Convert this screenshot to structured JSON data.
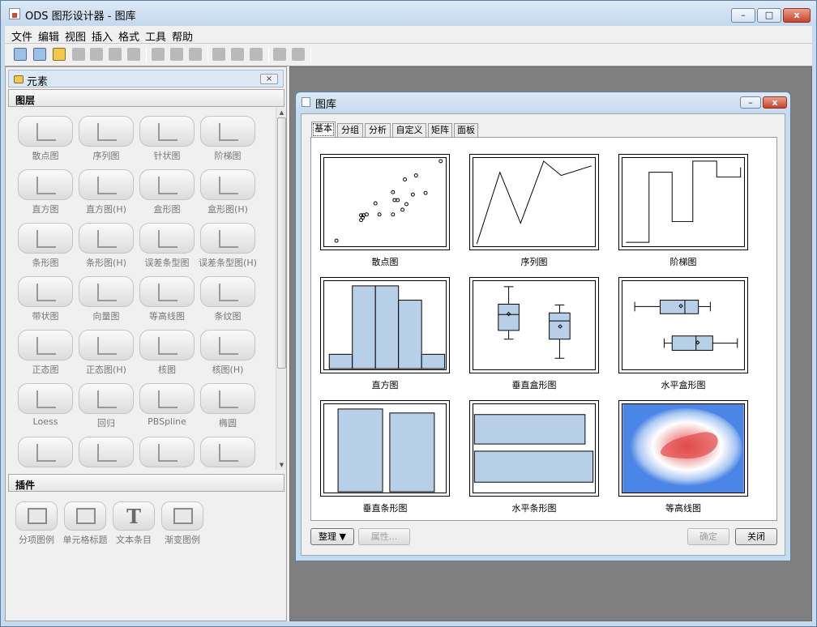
{
  "window": {
    "title": "ODS 图形设计器 - 图库",
    "controls": {
      "minimize": "–",
      "maximize": "□",
      "close": "x"
    }
  },
  "menu": [
    "文件",
    "编辑",
    "视图",
    "插入",
    "格式",
    "工具",
    "帮助"
  ],
  "toolbar": {
    "icons": [
      "new-graph-icon",
      "new-gallery-icon",
      "open-icon",
      "save-icon",
      "save-as-icon",
      "print-icon",
      "print-preview-icon",
      "undo-icon",
      "redo-icon",
      "copy-icon",
      "move-up-icon",
      "move-down-icon",
      "properties-icon",
      "align-icon",
      "layout-icon"
    ]
  },
  "element_panel": {
    "title": "元素",
    "close_label": "×",
    "layers_section": "图层",
    "plugins_section": "插件",
    "layers": [
      {
        "label": "散点图",
        "icon": "scatter-icon"
      },
      {
        "label": "序列图",
        "icon": "series-icon"
      },
      {
        "label": "针状图",
        "icon": "needle-icon"
      },
      {
        "label": "阶梯图",
        "icon": "step-icon"
      },
      {
        "label": "直方图",
        "icon": "histogram-icon"
      },
      {
        "label": "直方图(H)",
        "icon": "histogram-h-icon"
      },
      {
        "label": "盒形图",
        "icon": "box-icon"
      },
      {
        "label": "盒形图(H)",
        "icon": "box-h-icon"
      },
      {
        "label": "条形图",
        "icon": "bar-icon"
      },
      {
        "label": "条形图(H)",
        "icon": "bar-h-icon"
      },
      {
        "label": "误差条型图",
        "icon": "error-bar-icon"
      },
      {
        "label": "误差条型图(H)",
        "icon": "error-bar-h-icon"
      },
      {
        "label": "带状图",
        "icon": "band-icon"
      },
      {
        "label": "向量图",
        "icon": "vector-icon"
      },
      {
        "label": "等高线图",
        "icon": "contour-icon"
      },
      {
        "label": "条纹图",
        "icon": "fringe-icon"
      },
      {
        "label": "正态图",
        "icon": "normal-icon"
      },
      {
        "label": "正态图(H)",
        "icon": "normal-h-icon"
      },
      {
        "label": "核图",
        "icon": "kernel-icon"
      },
      {
        "label": "核图(H)",
        "icon": "kernel-h-icon"
      },
      {
        "label": "Loess",
        "icon": "loess-icon"
      },
      {
        "label": "回归",
        "icon": "regression-icon"
      },
      {
        "label": "PBSpline",
        "icon": "pbspline-icon"
      },
      {
        "label": "椭圆",
        "icon": "ellipse-icon"
      },
      {
        "label": "",
        "icon": "reference-line-icon"
      },
      {
        "label": "",
        "icon": "drop-line-icon"
      },
      {
        "label": "",
        "icon": "dashed-line-icon"
      },
      {
        "label": "",
        "icon": "line-parm-icon"
      }
    ],
    "plugins": [
      {
        "label": "分项图例",
        "icon": "legend-icon"
      },
      {
        "label": "单元格标题",
        "icon": "cell-title-icon"
      },
      {
        "label": "文本条目",
        "icon": "text-icon",
        "glyph": "T"
      },
      {
        "label": "渐变图例",
        "icon": "gradient-legend-icon"
      }
    ]
  },
  "gallery": {
    "title": "图库",
    "tabs": [
      "基本",
      "分组",
      "分析",
      "自定义",
      "矩阵",
      "面板"
    ],
    "selected_tab": "基本",
    "items": [
      {
        "label": "散点图"
      },
      {
        "label": "序列图"
      },
      {
        "label": "阶梯图"
      },
      {
        "label": "直方图"
      },
      {
        "label": "垂直盒形图"
      },
      {
        "label": "水平盒形图"
      },
      {
        "label": "垂直条形图"
      },
      {
        "label": "水平条形图"
      },
      {
        "label": "等高线图"
      }
    ],
    "organize_button": "整理",
    "properties_button": "属性...",
    "ok_button": "确定",
    "close_button": "关闭"
  },
  "colors": {
    "fill_blue": "#b8cfe8",
    "contour_blue": "#4a86e6",
    "contour_red": "#e34a4a"
  }
}
